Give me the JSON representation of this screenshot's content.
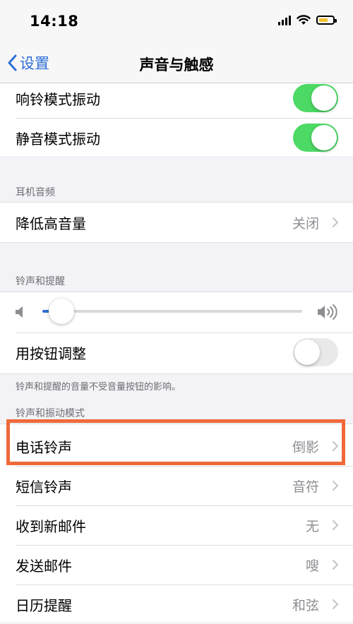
{
  "status_bar": {
    "time": "14:18",
    "icons": [
      "signal-icon",
      "wifi-icon",
      "battery-icon"
    ],
    "battery_color": "#f4c430"
  },
  "nav": {
    "back_label": "设置",
    "title": "声音与触感",
    "accent": "#2f6fd8"
  },
  "vibration": {
    "ring_vibrate": {
      "label": "响铃模式振动",
      "on": true
    },
    "silent_vibrate": {
      "label": "静音模式振动",
      "on": true
    }
  },
  "headphone_audio": {
    "header": "耳机音频",
    "reduce_loud": {
      "label": "降低高音量",
      "value": "关闭"
    }
  },
  "ringer_alerts": {
    "header": "铃声和提醒",
    "volume_level": 0.03,
    "change_with_buttons": {
      "label": "用按钮调整",
      "on": false
    },
    "footer": "铃声和提醒的音量不受音量按钮的影响。"
  },
  "sounds_patterns": {
    "header": "铃声和振动模式",
    "items": [
      {
        "label": "电话铃声",
        "value": "倒影"
      },
      {
        "label": "短信铃声",
        "value": "音符"
      },
      {
        "label": "收到新邮件",
        "value": "无"
      },
      {
        "label": "发送邮件",
        "value": "嗖"
      },
      {
        "label": "日历提醒",
        "value": "和弦"
      }
    ]
  },
  "colors": {
    "toggle_on": "#4cd964",
    "highlight": "#ef6a3a"
  }
}
